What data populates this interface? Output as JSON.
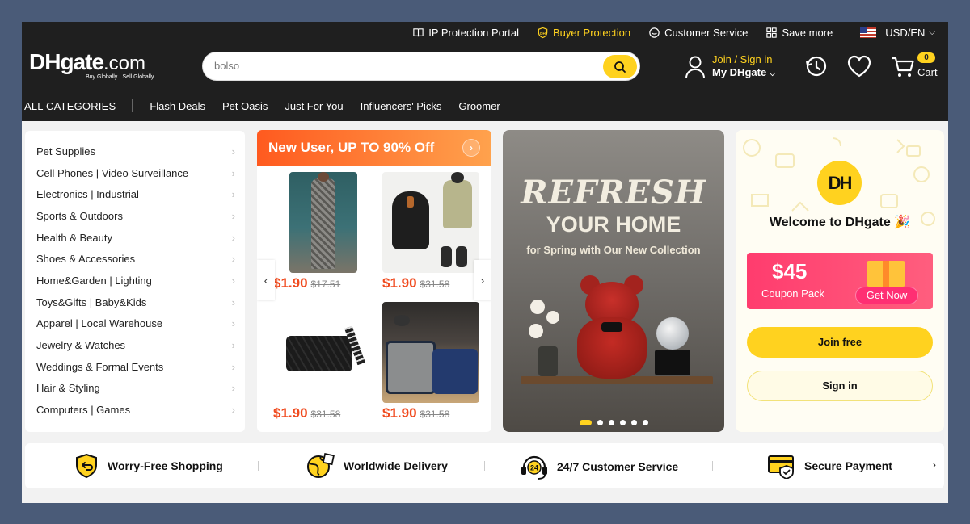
{
  "header": {
    "util_links": [
      {
        "label": "IP Protection Portal",
        "icon": "book-icon"
      },
      {
        "label": "Buyer Protection",
        "icon": "shield-icon"
      },
      {
        "label": "Customer Service",
        "icon": "chat-icon"
      },
      {
        "label": "Save more",
        "icon": "grid-icon"
      }
    ],
    "currency": "USD/EN",
    "logo_main": "DHgate",
    "logo_suffix": ".com",
    "logo_tagline": "Buy Globally · Sell Globally",
    "search_value": "bolso",
    "account_join": "Join / Sign in",
    "account_my": "My DHgate",
    "cart_count": "0",
    "cart_label": "Cart",
    "all_categories": "ALL CATEGORIES",
    "nav": [
      "Flash Deals",
      "Pet Oasis",
      "Just For You",
      "Influencers' Picks",
      "Groomer"
    ]
  },
  "sidebar": {
    "items": [
      "Pet Supplies",
      "Cell Phones | Video Surveillance",
      "Electronics | Industrial",
      "Sports & Outdoors",
      "Health & Beauty",
      "Shoes & Accessories",
      "Home&Garden | Lighting",
      "Toys&Gifts | Baby&Kids",
      "Apparel | Local Warehouse",
      "Jewelry & Watches",
      "Weddings & Formal Events",
      "Hair & Styling",
      "Computers | Games"
    ]
  },
  "promo": {
    "title": "New User, UP TO 90% Off",
    "products": [
      {
        "price": "$1.90",
        "orig": "$17.51"
      },
      {
        "price": "$1.90",
        "orig": "$31.58"
      },
      {
        "price": "$1.90",
        "orig": "$31.58"
      },
      {
        "price": "$1.90",
        "orig": "$31.58"
      }
    ]
  },
  "banner": {
    "line1": "REFRESH",
    "line2": "YOUR HOME",
    "line3": "for Spring with Our New Collection",
    "slides": 6,
    "active_slide": 1
  },
  "welcome": {
    "avatar": "DH",
    "title": "Welcome to DHgate 🎉",
    "coupon_amount": "$45",
    "coupon_label": "Coupon Pack",
    "coupon_cta": "Get Now",
    "join": "Join free",
    "sign_in": "Sign in"
  },
  "features": [
    {
      "label": "Worry-Free Shopping",
      "icon": "shield-return-icon"
    },
    {
      "label": "Worldwide Delivery",
      "icon": "globe-box-icon"
    },
    {
      "label": "24/7 Customer Service",
      "icon": "headset-24-icon"
    },
    {
      "label": "Secure Payment",
      "icon": "secure-card-icon"
    }
  ],
  "colors": {
    "accent": "#ffd21f",
    "dark": "#1f1f1f",
    "price": "#f04a1e",
    "promo": "#ff5a1f",
    "coupon": "#ff3c6e"
  }
}
